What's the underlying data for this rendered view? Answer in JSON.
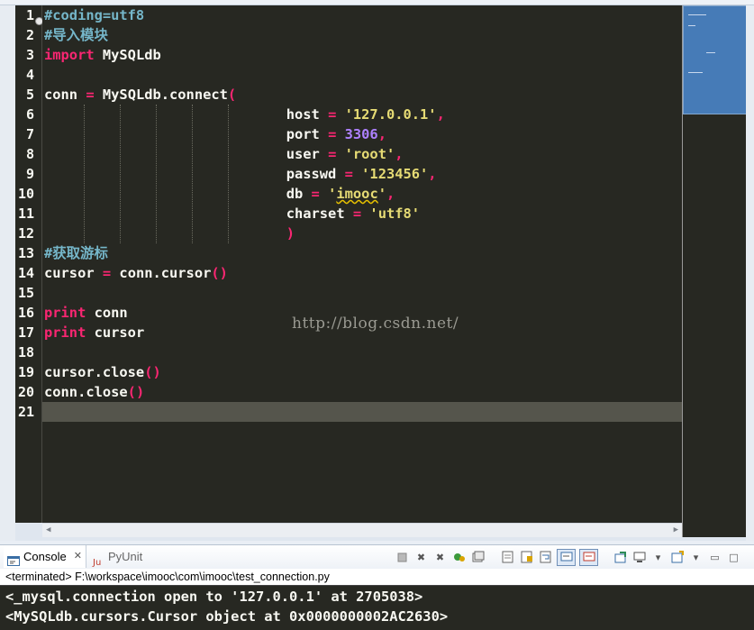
{
  "editor": {
    "line_numbers": [
      "1",
      "2",
      "3",
      "4",
      "5",
      "6",
      "7",
      "8",
      "9",
      "10",
      "11",
      "12",
      "13",
      "14",
      "15",
      "16",
      "17",
      "18",
      "19",
      "20",
      "21"
    ],
    "code": {
      "l1": "#coding=utf8",
      "l2": "#导入模块",
      "l3_kw": "import",
      "l3_rest": " MySQLdb",
      "l5_a": "conn ",
      "l5_eq": "=",
      "l5_b": " MySQLdb.connect",
      "l5_paren": "(",
      "indent": "                             ",
      "l6_key": "host ",
      "l6_val": "'127.0.0.1'",
      "l7_key": "port ",
      "l7_val": "3306",
      "l8_key": "user ",
      "l8_val": "'root'",
      "l9_key": "passwd ",
      "l9_val": "'123456'",
      "l10_key": "db ",
      "l10_q1": "'",
      "l10_val": "imooc",
      "l10_q2": "'",
      "l11_key": "charset ",
      "l11_val": "'utf8'",
      "l12_paren": ")",
      "l13": "#获取游标",
      "l14_a": "cursor ",
      "l14_b": " conn.cursor",
      "l14_paren": "()",
      "l16_kw": "print",
      "l16_rest": " conn",
      "l17_kw": "print",
      "l17_rest": " cursor",
      "l19_a": "cursor.close",
      "l19_paren": "()",
      "l20_a": "conn.close",
      "l20_paren": "()",
      "eq": "=",
      "eq_sp": " = ",
      "comma": ","
    },
    "watermark": "http://blog.csdn.net/"
  },
  "console": {
    "tabs": [
      {
        "label": "Console",
        "active": true
      },
      {
        "label": "PyUnit",
        "active": false
      }
    ],
    "status": "<terminated> F:\\workspace\\imooc\\com\\imooc\\test_connection.py",
    "output": [
      "<_mysql.connection open to '127.0.0.1' at 2705038>",
      "<MySQLdb.cursors.Cursor object at 0x0000000002AC2630>"
    ]
  },
  "colors": {
    "background": "#272822",
    "comment": "#75b6c9",
    "keyword": "#f92672",
    "string": "#e6db74",
    "number": "#ae81ff",
    "current_line": "#55554c"
  }
}
